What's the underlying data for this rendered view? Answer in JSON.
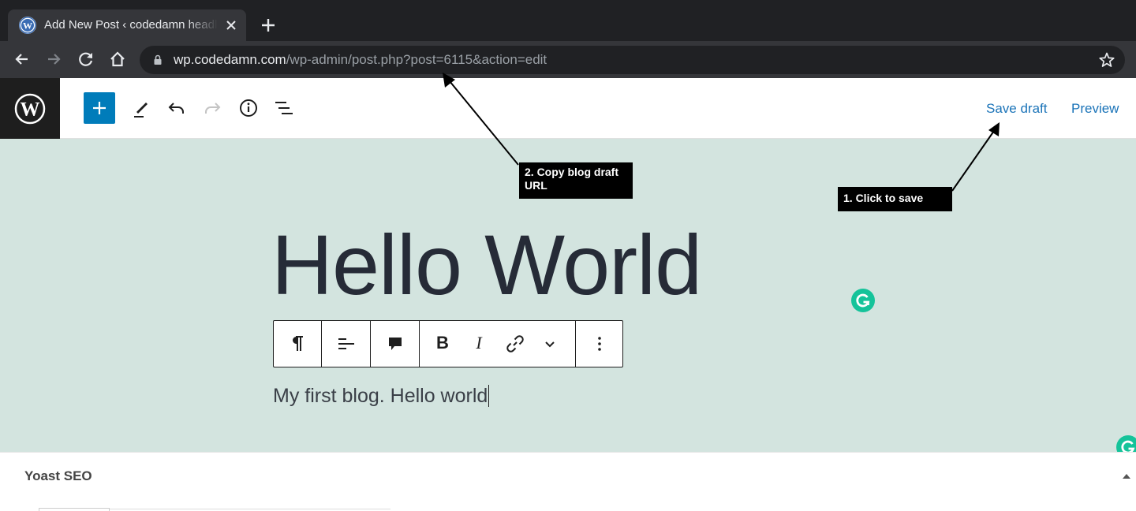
{
  "browser": {
    "tab_title": "Add New Post ‹ codedamn headless",
    "url_host": "wp.codedamn.com",
    "url_path": "/wp-admin/post.php?post=6115&action=edit"
  },
  "editor_header": {
    "save_draft_label": "Save draft",
    "preview_label": "Preview"
  },
  "post": {
    "title": "Hello World",
    "paragraph": "My first blog. Hello world"
  },
  "block_toolbar": {
    "bold_label": "B",
    "italic_label": "I"
  },
  "annotations": {
    "copy_url_note": "2. Copy blog draft URL",
    "save_note": "1. Click to save"
  },
  "yoast": {
    "title": "Yoast SEO"
  },
  "colors": {
    "wp_blue": "#007cba",
    "canvas_bg": "#d3e4df",
    "grammarly_green": "#15c39a"
  }
}
